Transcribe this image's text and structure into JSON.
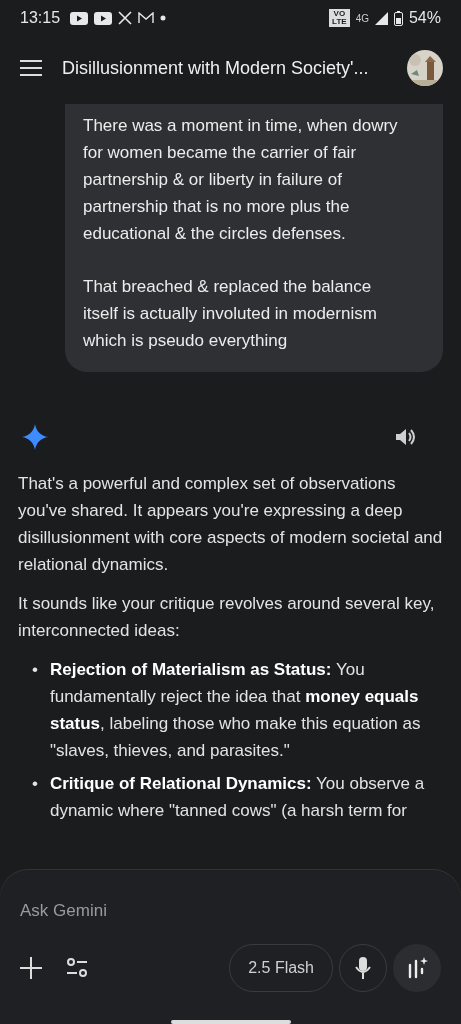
{
  "status_bar": {
    "time": "13:15",
    "volte": [
      "VO",
      "LTE"
    ],
    "network": "4G",
    "battery": "54%"
  },
  "header": {
    "title": "Disillusionment with Modern Society'..."
  },
  "user_message": {
    "paragraphs": [
      "There was a moment in time, when dowry for women became the carrier of fair partnership & or liberty in failure of partnership that is no more plus the educational & the circles defenses.",
      "That breached & replaced the balance itself is actually involuted in modernism which is pseudo everything"
    ]
  },
  "response": {
    "paragraphs": [
      "That's a powerful and complex set of observations you've shared. It appears you're expressing a deep disillusionment with core aspects of modern societal and relational dynamics.",
      "It sounds like your critique revolves around several key, interconnected ideas:"
    ],
    "bullets": [
      {
        "marker": "•",
        "text": "**Rejection of Materialism as Status:** You fundamentally reject the idea that **money equals status**, labeling those who make this equation as \"slaves, thieves, and parasites.\""
      },
      {
        "marker": "•",
        "text": "**Critique of Relational Dynamics:** You observe a dynamic where \"tanned cows\" (a harsh term for"
      }
    ]
  },
  "composer": {
    "placeholder": "Ask Gemini",
    "model": "2.5 Flash"
  }
}
